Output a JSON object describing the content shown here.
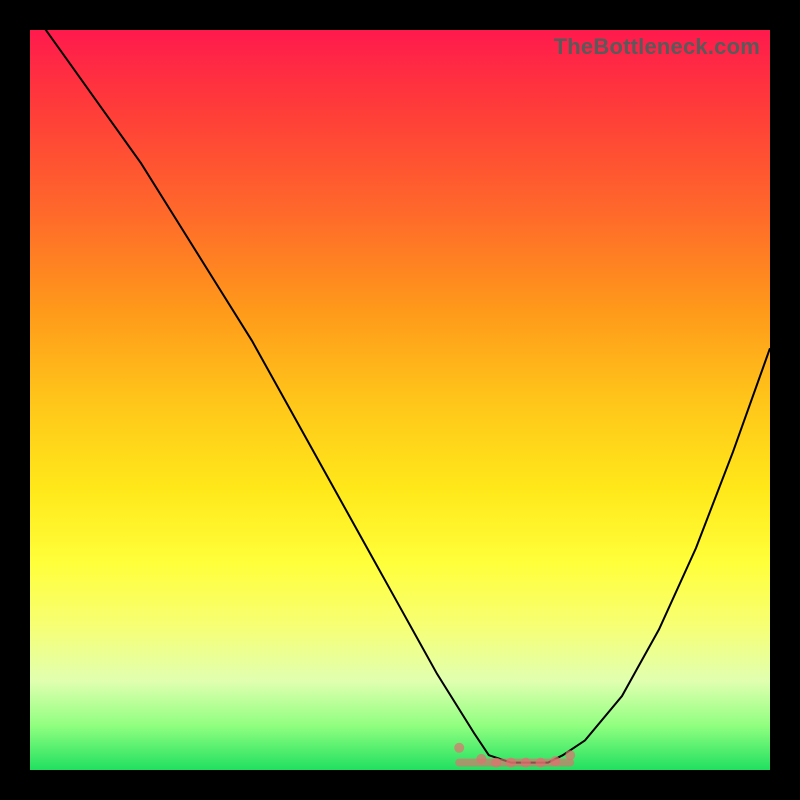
{
  "chart_data": {
    "type": "line",
    "watermark": "TheBottleneck.com",
    "title": "",
    "xlabel": "",
    "ylabel": "",
    "xlim": [
      0,
      100
    ],
    "ylim": [
      0,
      100
    ],
    "x": [
      0,
      5,
      10,
      15,
      20,
      25,
      30,
      35,
      40,
      45,
      50,
      55,
      60,
      62,
      65,
      68,
      70,
      72,
      75,
      80,
      85,
      90,
      95,
      100
    ],
    "values": [
      103,
      96,
      89,
      82,
      74,
      66,
      58,
      49,
      40,
      31,
      22,
      13,
      5,
      2,
      1,
      1,
      1,
      2,
      4,
      10,
      19,
      30,
      43,
      57
    ],
    "flat_region": {
      "x_start": 58,
      "x_end": 73,
      "y": 1
    },
    "dots": [
      {
        "x": 58,
        "y": 3
      },
      {
        "x": 61,
        "y": 1.5
      },
      {
        "x": 63,
        "y": 1
      },
      {
        "x": 65,
        "y": 1
      },
      {
        "x": 67,
        "y": 1
      },
      {
        "x": 69,
        "y": 1
      },
      {
        "x": 71,
        "y": 1.2
      },
      {
        "x": 73,
        "y": 2
      }
    ],
    "gradient_description": "red (top, high bottleneck) to green (bottom, low bottleneck)"
  }
}
